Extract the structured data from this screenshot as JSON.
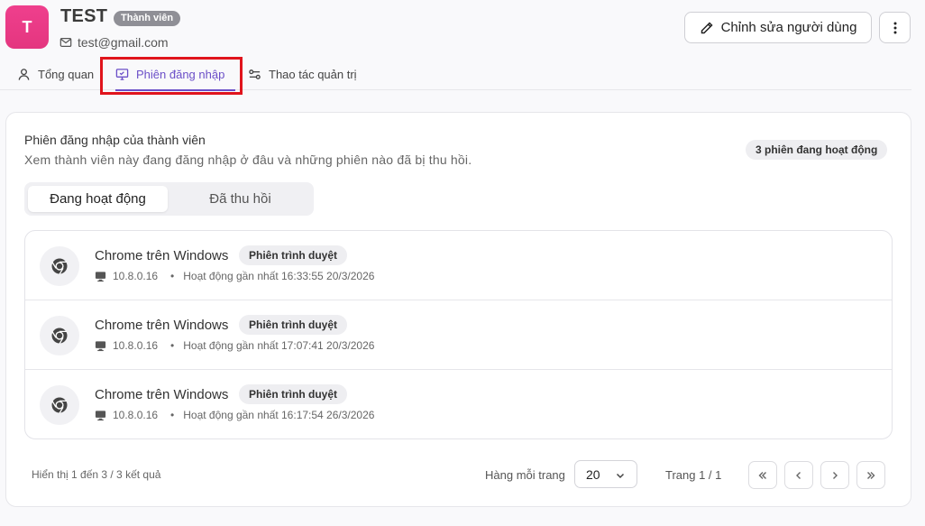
{
  "user": {
    "avatar_letter": "T",
    "name": "TEST",
    "role": "Thành viên",
    "email": "test@gmail.com"
  },
  "header": {
    "edit_label": "Chỉnh sửa người dùng",
    "more_icon": "more-vertical-icon"
  },
  "tabs": [
    {
      "label": "Tổng quan",
      "icon": "user-icon",
      "active": false
    },
    {
      "label": "Phiên đăng nhập",
      "icon": "monitor-icon",
      "active": true
    },
    {
      "label": "Thao tác quản trị",
      "icon": "sliders-icon",
      "active": false
    }
  ],
  "sessions": {
    "title": "Phiên đăng nhập của thành viên",
    "subtitle": "Xem thành viên này đang đăng nhập ở đâu và những phiên nào đã bị thu hồi.",
    "active_count_label": "3 phiên đang hoạt động",
    "filter": {
      "active_label": "Đang hoạt động",
      "revoked_label": "Đã thu hồi",
      "selected": "active"
    },
    "items": [
      {
        "title": "Chrome trên Windows",
        "type": "Phiên trình duyệt",
        "ip": "10.8.0.16",
        "last_active": "Hoạt động gần nhất 16:33:55 20/3/2026"
      },
      {
        "title": "Chrome trên Windows",
        "type": "Phiên trình duyệt",
        "ip": "10.8.0.16",
        "last_active": "Hoạt động gần nhất 17:07:41 20/3/2026"
      },
      {
        "title": "Chrome trên Windows",
        "type": "Phiên trình duyệt",
        "ip": "10.8.0.16",
        "last_active": "Hoạt động gần nhất 16:17:54 26/3/2026"
      }
    ]
  },
  "pagination": {
    "summary": "Hiển thị 1 đến 3 / 3 kết quả",
    "rows_label": "Hàng mỗi trang",
    "rows_value": "20",
    "page_info": "Trang 1 / 1"
  },
  "colors": {
    "accent": "#6b4fc8",
    "avatar": "#e4367f",
    "highlight": "#e0141c"
  }
}
